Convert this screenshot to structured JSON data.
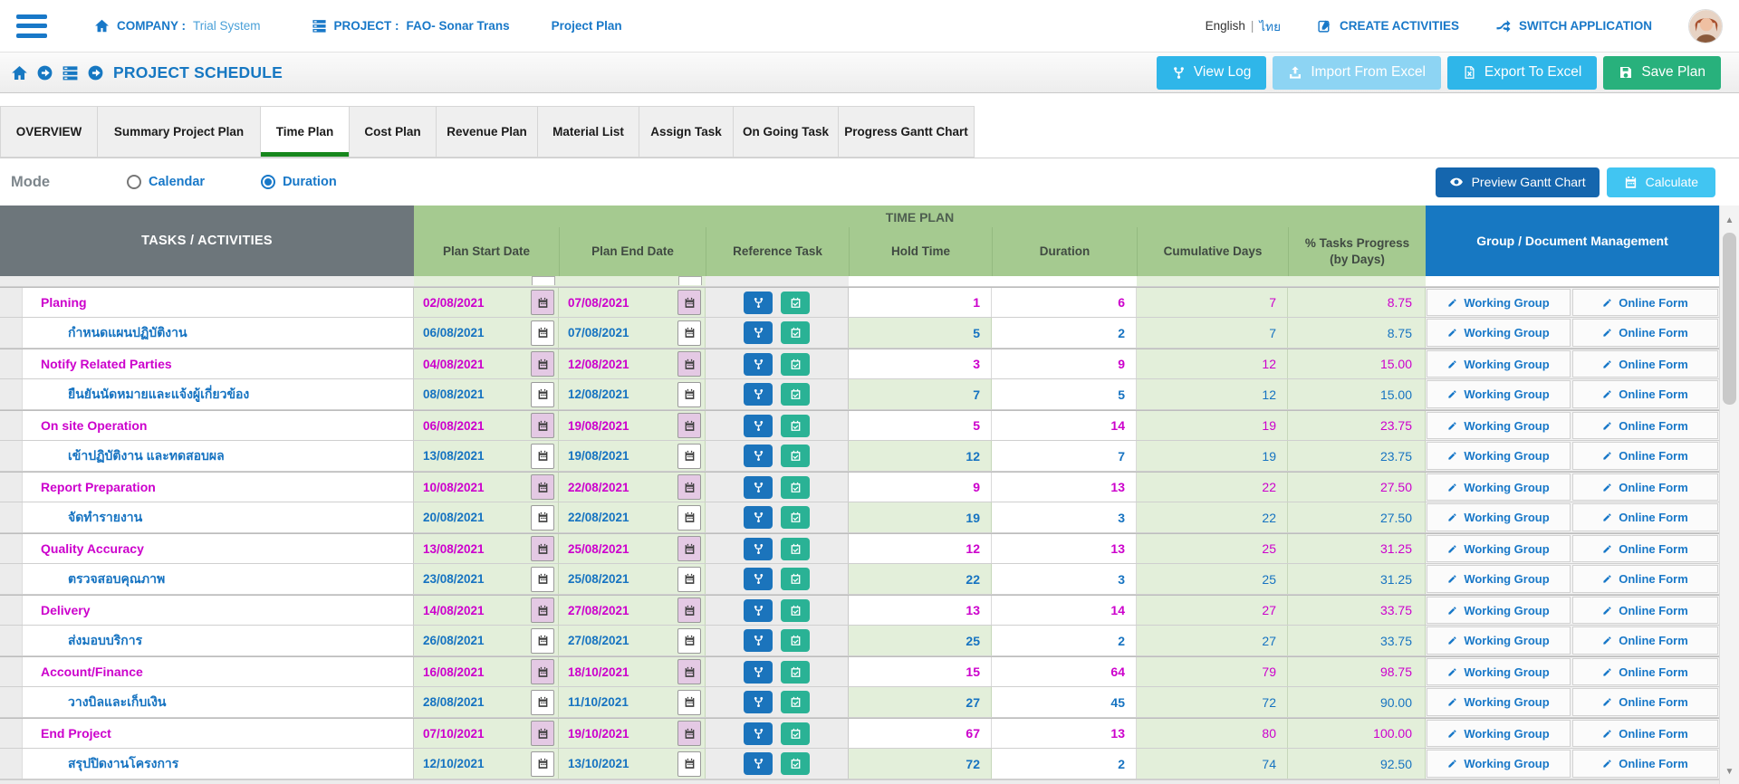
{
  "topbar": {
    "company_label": "COMPANY :",
    "company_value": "Trial System",
    "project_label": "PROJECT :",
    "project_value": "FAO- Sonar Trans",
    "project_plan_link": "Project Plan",
    "lang_primary": "English",
    "lang_separator": "|",
    "lang_secondary": "ไทย",
    "create_activities": "CREATE ACTIVITIES",
    "switch_application": "SWITCH APPLICATION"
  },
  "pagebar": {
    "title": "PROJECT SCHEDULE",
    "view_log": "View Log",
    "import_excel": "Import From Excel",
    "export_excel": "Export To Excel",
    "save_plan": "Save Plan"
  },
  "tabs": [
    {
      "label": "OVERVIEW",
      "active": false
    },
    {
      "label": "Summary Project Plan",
      "active": false
    },
    {
      "label": "Time Plan",
      "active": true
    },
    {
      "label": "Cost Plan",
      "active": false
    },
    {
      "label": "Revenue Plan",
      "active": false
    },
    {
      "label": "Material List",
      "active": false
    },
    {
      "label": "Assign Task",
      "active": false
    },
    {
      "label": "On Going Task",
      "active": false
    },
    {
      "label": "Progress Gantt Chart",
      "active": false
    }
  ],
  "modebar": {
    "label": "Mode",
    "options": [
      {
        "label": "Calendar",
        "checked": false
      },
      {
        "label": "Duration",
        "checked": true
      }
    ],
    "preview_button": "Preview Gantt Chart",
    "calculate_button": "Calculate"
  },
  "table": {
    "tasks_header": "TASKS / ACTIVITIES",
    "group_header": "TIME PLAN",
    "doc_header": "Group / Document Management",
    "columns": [
      "Plan Start Date",
      "Plan End Date",
      "Reference Task",
      "Hold Time",
      "Duration",
      "Cumulative Days"
    ],
    "pct_header": {
      "line1": "% Tasks Progress",
      "line2": "(by Days)"
    },
    "links": {
      "working_group": "Working Group",
      "online_form": "Online Form"
    },
    "rows": [
      {
        "task": "Planing",
        "type": "parent",
        "start": "02/08/2021",
        "end": "07/08/2021",
        "hold": "1",
        "duration": "6",
        "cumulative": "7",
        "progress": "8.75"
      },
      {
        "task": "กำหนดแผนปฏิบัติงาน",
        "type": "child",
        "start": "06/08/2021",
        "end": "07/08/2021",
        "hold": "5",
        "duration": "2",
        "cumulative": "7",
        "progress": "8.75"
      },
      {
        "task": "Notify Related Parties",
        "type": "parent",
        "start": "04/08/2021",
        "end": "12/08/2021",
        "hold": "3",
        "duration": "9",
        "cumulative": "12",
        "progress": "15.00"
      },
      {
        "task": "ยืนยันนัดหมายและแจ้งผู้เกี่ยวข้อง",
        "type": "child",
        "start": "08/08/2021",
        "end": "12/08/2021",
        "hold": "7",
        "duration": "5",
        "cumulative": "12",
        "progress": "15.00"
      },
      {
        "task": "On site Operation",
        "type": "parent",
        "start": "06/08/2021",
        "end": "19/08/2021",
        "hold": "5",
        "duration": "14",
        "cumulative": "19",
        "progress": "23.75"
      },
      {
        "task": "เข้าปฏิบัติงาน และทดสอบผล",
        "type": "child",
        "start": "13/08/2021",
        "end": "19/08/2021",
        "hold": "12",
        "duration": "7",
        "cumulative": "19",
        "progress": "23.75"
      },
      {
        "task": "Report Preparation",
        "type": "parent",
        "start": "10/08/2021",
        "end": "22/08/2021",
        "hold": "9",
        "duration": "13",
        "cumulative": "22",
        "progress": "27.50"
      },
      {
        "task": "จัดทำรายงาน",
        "type": "child",
        "start": "20/08/2021",
        "end": "22/08/2021",
        "hold": "19",
        "duration": "3",
        "cumulative": "22",
        "progress": "27.50"
      },
      {
        "task": "Quality Accuracy",
        "type": "parent",
        "start": "13/08/2021",
        "end": "25/08/2021",
        "hold": "12",
        "duration": "13",
        "cumulative": "25",
        "progress": "31.25"
      },
      {
        "task": "ตรวจสอบคุณภาพ",
        "type": "child",
        "start": "23/08/2021",
        "end": "25/08/2021",
        "hold": "22",
        "duration": "3",
        "cumulative": "25",
        "progress": "31.25"
      },
      {
        "task": "Delivery",
        "type": "parent",
        "start": "14/08/2021",
        "end": "27/08/2021",
        "hold": "13",
        "duration": "14",
        "cumulative": "27",
        "progress": "33.75"
      },
      {
        "task": "ส่งมอบบริการ",
        "type": "child",
        "start": "26/08/2021",
        "end": "27/08/2021",
        "hold": "25",
        "duration": "2",
        "cumulative": "27",
        "progress": "33.75"
      },
      {
        "task": "Account/Finance",
        "type": "parent",
        "start": "16/08/2021",
        "end": "18/10/2021",
        "hold": "15",
        "duration": "64",
        "cumulative": "79",
        "progress": "98.75"
      },
      {
        "task": "วางบิลและเก็บเงิน",
        "type": "child",
        "start": "28/08/2021",
        "end": "11/10/2021",
        "hold": "27",
        "duration": "45",
        "cumulative": "72",
        "progress": "90.00"
      },
      {
        "task": "End Project",
        "type": "parent",
        "start": "07/10/2021",
        "end": "19/10/2021",
        "hold": "67",
        "duration": "13",
        "cumulative": "80",
        "progress": "100.00"
      },
      {
        "task": "สรุปปิดงานโครงการ",
        "type": "child",
        "start": "12/10/2021",
        "end": "13/10/2021",
        "hold": "72",
        "duration": "2",
        "cumulative": "74",
        "progress": "92.50"
      }
    ]
  },
  "colors": {
    "brand_blue": "#1878c8",
    "header_gray": "#6d767b",
    "header_green": "#a5ca90",
    "header_blue": "#1778c2",
    "cell_green": "#e3efda",
    "parent_text": "#cc00cc",
    "child_text": "#1673c1",
    "button_cyan": "#2fb6e9",
    "button_cyan_light": "#8dd4f3",
    "button_green": "#28b17c",
    "preview_blue": "#1566ae",
    "calculate_cyan": "#41c5f2",
    "tab_underline_green": "#17871d",
    "calendar_parent_bg": "#e4c9e4",
    "ref_branch_blue": "#1b74bc",
    "ref_calendar_teal": "#2ab295"
  }
}
